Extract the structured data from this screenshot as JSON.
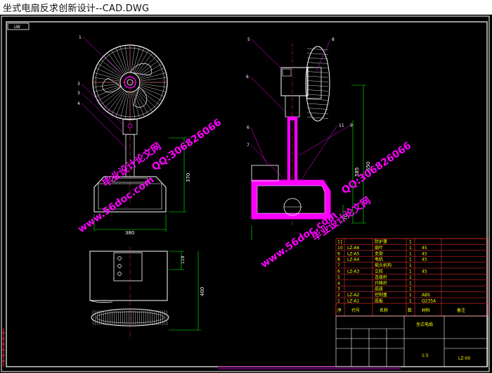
{
  "window": {
    "title": "坐式电扇反求创新设计--CAD.DWG"
  },
  "drawing": {
    "frame_tag": "LW",
    "dimensions": {
      "base_width": "380",
      "stand_height": "370",
      "total_height": "650",
      "mid_height": "585",
      "base_height": "70",
      "top_depth": "119",
      "top_length": "400"
    },
    "balloons": [
      "1",
      "3",
      "3",
      "4",
      "5",
      "6",
      "7",
      "8",
      "9",
      "11",
      "11",
      "5",
      "6"
    ],
    "watermarks": {
      "qq": "QQ:306826066",
      "site": "www.56doc.com",
      "brand": "毕业设计论文网"
    },
    "parts_table": {
      "rows": [
        [
          "11",
          "",
          "防护罩",
          "1",
          ""
        ],
        [
          "10",
          "LZ-A6",
          "扇叶",
          "1",
          "45"
        ],
        [
          "9",
          "LZ-A5",
          "支架",
          "1",
          "45"
        ],
        [
          "8",
          "LZ-A4",
          "电机",
          "1",
          "45"
        ],
        [
          "7",
          "",
          "摇头机构",
          "1",
          ""
        ],
        [
          "6",
          "LZ-A3",
          "立柱",
          "1",
          "45"
        ],
        [
          "5",
          "",
          "连接杆",
          "1",
          ""
        ],
        [
          "4",
          "",
          "升降杆",
          "1",
          ""
        ],
        [
          "3",
          "",
          "底座",
          "1",
          ""
        ],
        [
          "2",
          "LZ-A2",
          "控制盒",
          "1",
          "ABS"
        ],
        [
          "1",
          "LZ-A1",
          "底板",
          "1",
          "Q235A"
        ]
      ],
      "header": [
        "序",
        "代号",
        "名称",
        "数",
        "材料",
        "备注"
      ],
      "title_block": {
        "name": "坐式电扇",
        "drawing_no": "LZ-00",
        "sheet": "1:5"
      }
    }
  }
}
